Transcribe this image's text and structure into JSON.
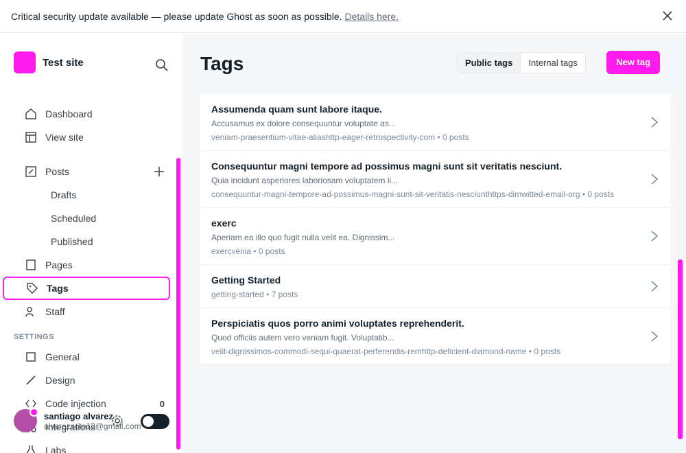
{
  "banner": {
    "message": "Critical security update available — please update Ghost as soon as possible.",
    "link": "Details here."
  },
  "sidebar": {
    "site_title": "Test site",
    "nav": [
      {
        "label": "Dashboard",
        "icon": "home-icon"
      },
      {
        "label": "View site",
        "icon": "browser-icon"
      }
    ],
    "content_nav": [
      {
        "label": "Posts",
        "icon": "edit-icon"
      },
      {
        "label": "Drafts",
        "sub": true
      },
      {
        "label": "Scheduled",
        "sub": true
      },
      {
        "label": "Published",
        "sub": true
      },
      {
        "label": "Pages",
        "icon": "page-icon"
      },
      {
        "label": "Tags",
        "icon": "tag-icon",
        "active": true
      },
      {
        "label": "Staff",
        "icon": "staff-icon"
      }
    ],
    "settings_label": "SETTINGS",
    "settings_nav": [
      {
        "label": "General",
        "icon": "settings-icon"
      },
      {
        "label": "Design",
        "icon": "paintbrush-icon"
      },
      {
        "label": "Code injection",
        "icon": "code-icon"
      },
      {
        "label": "Integrations",
        "icon": "integrations-icon"
      },
      {
        "label": "Labs",
        "icon": "flask-icon"
      }
    ],
    "members_count": "0",
    "user": {
      "name": "santiago alvarez",
      "email": "alvarezsoto13@gmail.com"
    }
  },
  "main": {
    "title": "Tags",
    "tabs": [
      "Public tags",
      "Internal tags"
    ],
    "active_tab": "Public tags",
    "new_tag_label": "New tag",
    "tags": [
      {
        "name": "Assumenda quam sunt labore itaque.",
        "description": "Accusamus ex dolore consequuntur voluptate as...",
        "slug": "veniam-praesentium-vitae-aliashttp-eager-retrospectivity-com",
        "posts": "0 posts"
      },
      {
        "name": "Consequuntur magni tempore ad possimus magni sunt sit veritatis nesciunt.",
        "description": "Quia incidunt asperiores laboriosam voluptatem li...",
        "slug": "consequuntur-magni-tempore-ad-possimus-magni-sunt-sit-veritatis-nesciunthttps-dimwitted-email-org",
        "posts": "0 posts"
      },
      {
        "name": "exerc",
        "description": "Aperiam ea illo quo fugit nulla velit ea. Dignissim...",
        "slug": "exercvenia",
        "posts": "0 posts"
      },
      {
        "name": "Getting Started",
        "description": "",
        "slug": "getting-started",
        "posts": "7 posts"
      },
      {
        "name": "Perspiciatis quos porro animi voluptates reprehenderit.",
        "description": "Quod officiis autem vero veniam fugit. Voluptatib...",
        "slug": "velit-dignissimos-commodi-sequi-quaerat-perferendis-remhttp-deficient-diamond-name",
        "posts": "0 posts"
      }
    ]
  }
}
